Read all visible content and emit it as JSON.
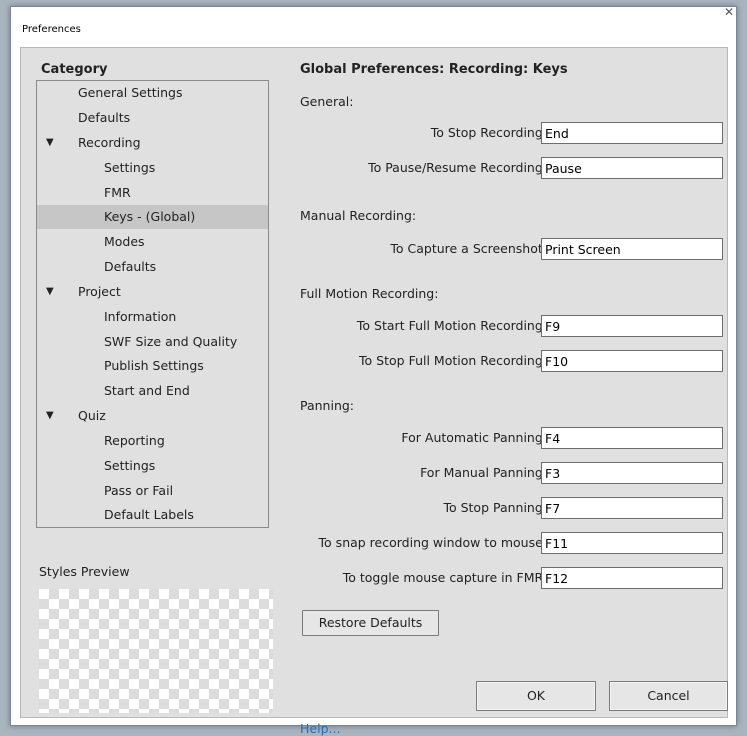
{
  "window": {
    "title": "Preferences"
  },
  "category": {
    "heading": "Category",
    "items": [
      {
        "label": "General Settings",
        "level": 1,
        "expanded": false,
        "selected": false
      },
      {
        "label": "Defaults",
        "level": 1,
        "expanded": false,
        "selected": false
      },
      {
        "label": "Recording",
        "level": 1,
        "expanded": true,
        "selected": false
      },
      {
        "label": "Settings",
        "level": 2,
        "expanded": false,
        "selected": false
      },
      {
        "label": "FMR",
        "level": 2,
        "expanded": false,
        "selected": false
      },
      {
        "label": "Keys - (Global)",
        "level": 2,
        "expanded": false,
        "selected": true
      },
      {
        "label": "Modes",
        "level": 2,
        "expanded": false,
        "selected": false
      },
      {
        "label": "Defaults",
        "level": 2,
        "expanded": false,
        "selected": false
      },
      {
        "label": "Project",
        "level": 1,
        "expanded": true,
        "selected": false
      },
      {
        "label": "Information",
        "level": 2,
        "expanded": false,
        "selected": false
      },
      {
        "label": "SWF Size and Quality",
        "level": 2,
        "expanded": false,
        "selected": false
      },
      {
        "label": "Publish Settings",
        "level": 2,
        "expanded": false,
        "selected": false
      },
      {
        "label": "Start and End",
        "level": 2,
        "expanded": false,
        "selected": false
      },
      {
        "label": "Quiz",
        "level": 1,
        "expanded": true,
        "selected": false
      },
      {
        "label": "Reporting",
        "level": 2,
        "expanded": false,
        "selected": false
      },
      {
        "label": "Settings",
        "level": 2,
        "expanded": false,
        "selected": false
      },
      {
        "label": "Pass or Fail",
        "level": 2,
        "expanded": false,
        "selected": false
      },
      {
        "label": "Default Labels",
        "level": 2,
        "expanded": false,
        "selected": false
      }
    ],
    "expand_glyph": "▼"
  },
  "styles_preview": {
    "label": "Styles Preview"
  },
  "panel": {
    "heading": "Global Preferences: Recording: Keys",
    "sections": {
      "general": "General:",
      "manual": "Manual Recording:",
      "full_motion": "Full Motion Recording:",
      "panning": "Panning:"
    },
    "fields": [
      {
        "label": "To Stop Recording:",
        "value": "End"
      },
      {
        "label": "To Pause/Resume Recording:",
        "value": "Pause"
      },
      {
        "label": "To Capture a Screenshot:",
        "value": "Print Screen"
      },
      {
        "label": "To Start Full Motion Recording:",
        "value": "F9"
      },
      {
        "label": "To Stop Full Motion Recording:",
        "value": "F10"
      },
      {
        "label": "For Automatic Panning:",
        "value": "F4"
      },
      {
        "label": "For Manual Panning:",
        "value": "F3"
      },
      {
        "label": "To Stop Panning:",
        "value": "F7"
      },
      {
        "label": "To snap recording window to mouse:",
        "value": "F11"
      },
      {
        "label": "To toggle mouse capture in FMR:",
        "value": "F12"
      }
    ],
    "restore_defaults": "Restore Defaults"
  },
  "footer": {
    "help": "Help...",
    "ok": "OK",
    "cancel": "Cancel"
  },
  "colors": {
    "link": "#1f6fbf",
    "selection": "#c6c6c6",
    "panel_bg": "#e0e0e0"
  }
}
